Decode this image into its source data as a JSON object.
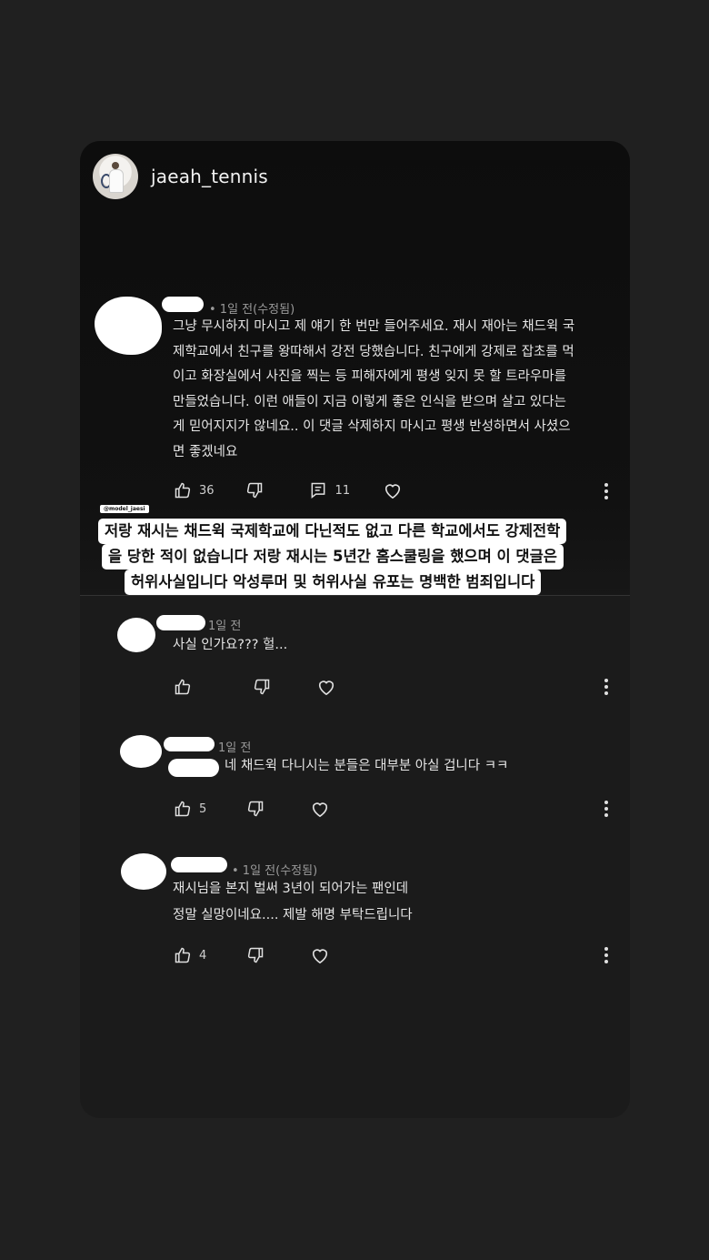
{
  "profile": {
    "username": "jaeah_tennis"
  },
  "comments": [
    {
      "meta": "• 1일 전(수정됨)",
      "text": "그냥 무시하지 마시고 제 얘기 한 번만 들어주세요. 재시 재아는 채드윅 국\n제학교에서 친구를 왕따해서 강전 당했습니다. 친구에게 강제로 잡초를 먹\n이고 화장실에서 사진을 찍는 등 피해자에게 평생 잊지 못 할 트라우마를\n만들었습니다. 이런 애들이 지금 이렇게 좋은 인식을 받으며 살고 있다는\n게 믿어지지가 않네요.. 이 댓글 삭제하지 마시고 평생 반성하면서 사셨으\n면 좋겠네요",
      "likes": "36",
      "replies": "11"
    },
    {
      "meta": "1일 전",
      "text": "사실 인가요??? 헐...",
      "likes": ""
    },
    {
      "meta": "1일 전",
      "text": "네 채드윅 다니시는 분들은 대부분 아실 겁니다 ㅋㅋ",
      "likes": "5"
    },
    {
      "meta": "• 1일 전(수정됨)",
      "text": "재시님을 본지 벌써 3년이 되어가는 팬인데\n정말 실망이네요.... 제발 해명 부탁드립니다",
      "likes": "4"
    }
  ],
  "overlay": {
    "tag": "@model_jaesi",
    "lines": [
      "저랑 재시는 채드윅 국제학교에 다닌적도 없고 다른 학교에서도 강제전학",
      "을 당한 적이 없습니다 저랑 재시는 5년간 홈스쿨링을 했으며 이 댓글은",
      "허위사실입니다 악성루머 및 허위사실 유포는 명백한 범죄입니다"
    ]
  },
  "icons": [
    "thumbs-up-icon",
    "thumbs-down-icon",
    "reply-icon",
    "heart-icon",
    "more-vert-icon"
  ]
}
